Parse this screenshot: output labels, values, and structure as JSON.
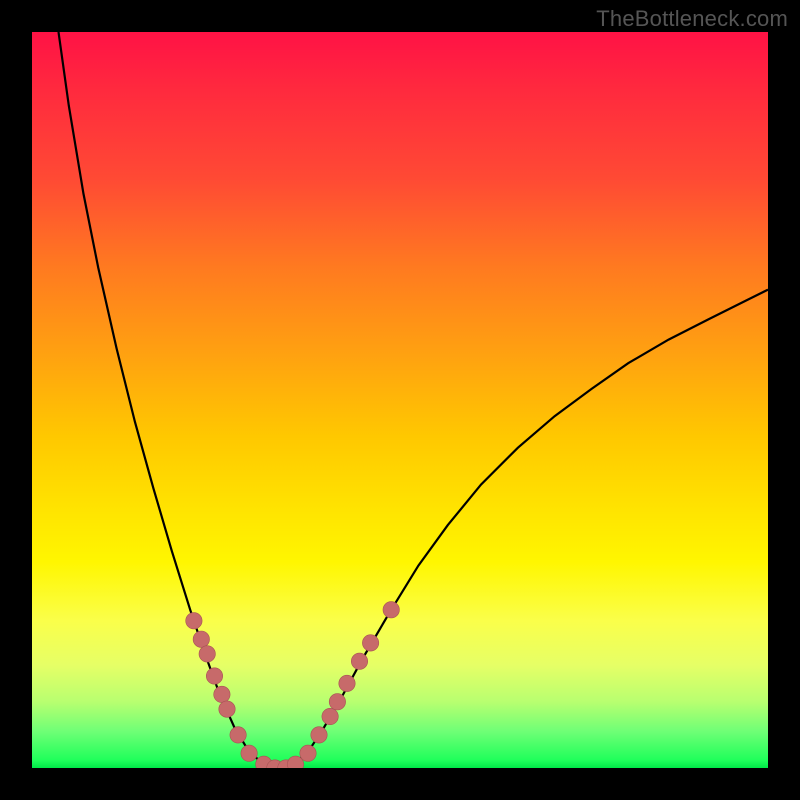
{
  "watermark": "TheBottleneck.com",
  "chart_data": {
    "type": "line",
    "title": "",
    "xlabel": "",
    "ylabel": "",
    "xlim": [
      0,
      100
    ],
    "ylim": [
      0,
      100
    ],
    "grid": false,
    "curve": [
      {
        "x": 3.6,
        "y": 100.0
      },
      {
        "x": 5.0,
        "y": 90.0
      },
      {
        "x": 7.0,
        "y": 78.0
      },
      {
        "x": 9.0,
        "y": 68.0
      },
      {
        "x": 11.5,
        "y": 57.0
      },
      {
        "x": 14.0,
        "y": 47.0
      },
      {
        "x": 16.5,
        "y": 38.0
      },
      {
        "x": 19.0,
        "y": 29.5
      },
      {
        "x": 21.5,
        "y": 21.5
      },
      {
        "x": 23.5,
        "y": 15.5
      },
      {
        "x": 25.5,
        "y": 10.0
      },
      {
        "x": 27.5,
        "y": 5.5
      },
      {
        "x": 29.5,
        "y": 2.2
      },
      {
        "x": 31.5,
        "y": 0.5
      },
      {
        "x": 33.5,
        "y": 0.0
      },
      {
        "x": 35.5,
        "y": 0.5
      },
      {
        "x": 37.5,
        "y": 2.2
      },
      {
        "x": 39.5,
        "y": 5.2
      },
      {
        "x": 42.0,
        "y": 9.5
      },
      {
        "x": 45.0,
        "y": 15.0
      },
      {
        "x": 48.5,
        "y": 21.0
      },
      {
        "x": 52.5,
        "y": 27.5
      },
      {
        "x": 56.5,
        "y": 33.0
      },
      {
        "x": 61.0,
        "y": 38.5
      },
      {
        "x": 66.0,
        "y": 43.5
      },
      {
        "x": 71.0,
        "y": 47.8
      },
      {
        "x": 76.0,
        "y": 51.5
      },
      {
        "x": 81.0,
        "y": 55.0
      },
      {
        "x": 86.5,
        "y": 58.2
      },
      {
        "x": 92.0,
        "y": 61.0
      },
      {
        "x": 97.0,
        "y": 63.5
      },
      {
        "x": 100.0,
        "y": 65.0
      }
    ],
    "markers": [
      {
        "x": 22.0,
        "y": 20.0
      },
      {
        "x": 23.0,
        "y": 17.5
      },
      {
        "x": 23.8,
        "y": 15.5
      },
      {
        "x": 24.8,
        "y": 12.5
      },
      {
        "x": 25.8,
        "y": 10.0
      },
      {
        "x": 26.5,
        "y": 8.0
      },
      {
        "x": 28.0,
        "y": 4.5
      },
      {
        "x": 29.5,
        "y": 2.0
      },
      {
        "x": 31.5,
        "y": 0.5
      },
      {
        "x": 33.0,
        "y": 0.0
      },
      {
        "x": 34.5,
        "y": 0.0
      },
      {
        "x": 35.8,
        "y": 0.5
      },
      {
        "x": 37.5,
        "y": 2.0
      },
      {
        "x": 39.0,
        "y": 4.5
      },
      {
        "x": 40.5,
        "y": 7.0
      },
      {
        "x": 41.5,
        "y": 9.0
      },
      {
        "x": 42.8,
        "y": 11.5
      },
      {
        "x": 44.5,
        "y": 14.5
      },
      {
        "x": 46.0,
        "y": 17.0
      },
      {
        "x": 48.8,
        "y": 21.5
      }
    ],
    "marker_color": "#c76a6a"
  }
}
